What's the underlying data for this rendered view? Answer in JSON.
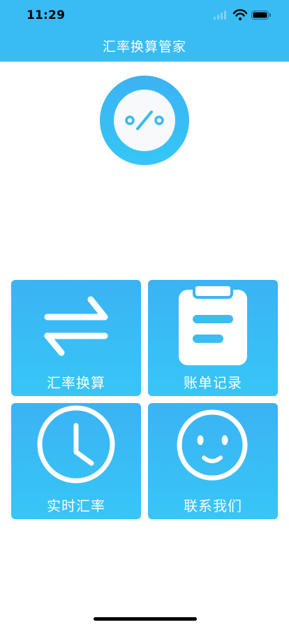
{
  "status_bar": {
    "time": "11:29",
    "icons": [
      "signal-icon",
      "wifi-icon",
      "battery-icon"
    ]
  },
  "nav": {
    "title": "汇率换算管家"
  },
  "logo": {
    "icon": "percent-icon"
  },
  "menu": {
    "tiles": [
      {
        "label": "汇率换算",
        "icon": "swap-arrows-icon"
      },
      {
        "label": "账单记录",
        "icon": "clipboard-icon"
      },
      {
        "label": "实时汇率",
        "icon": "clock-icon"
      },
      {
        "label": "联系我们",
        "icon": "smiley-icon"
      }
    ]
  },
  "colors": {
    "accent": "#39bcf4",
    "tile_top": "#3bb3f3",
    "tile_bottom": "#37c6f6",
    "background": "#ffffff"
  }
}
